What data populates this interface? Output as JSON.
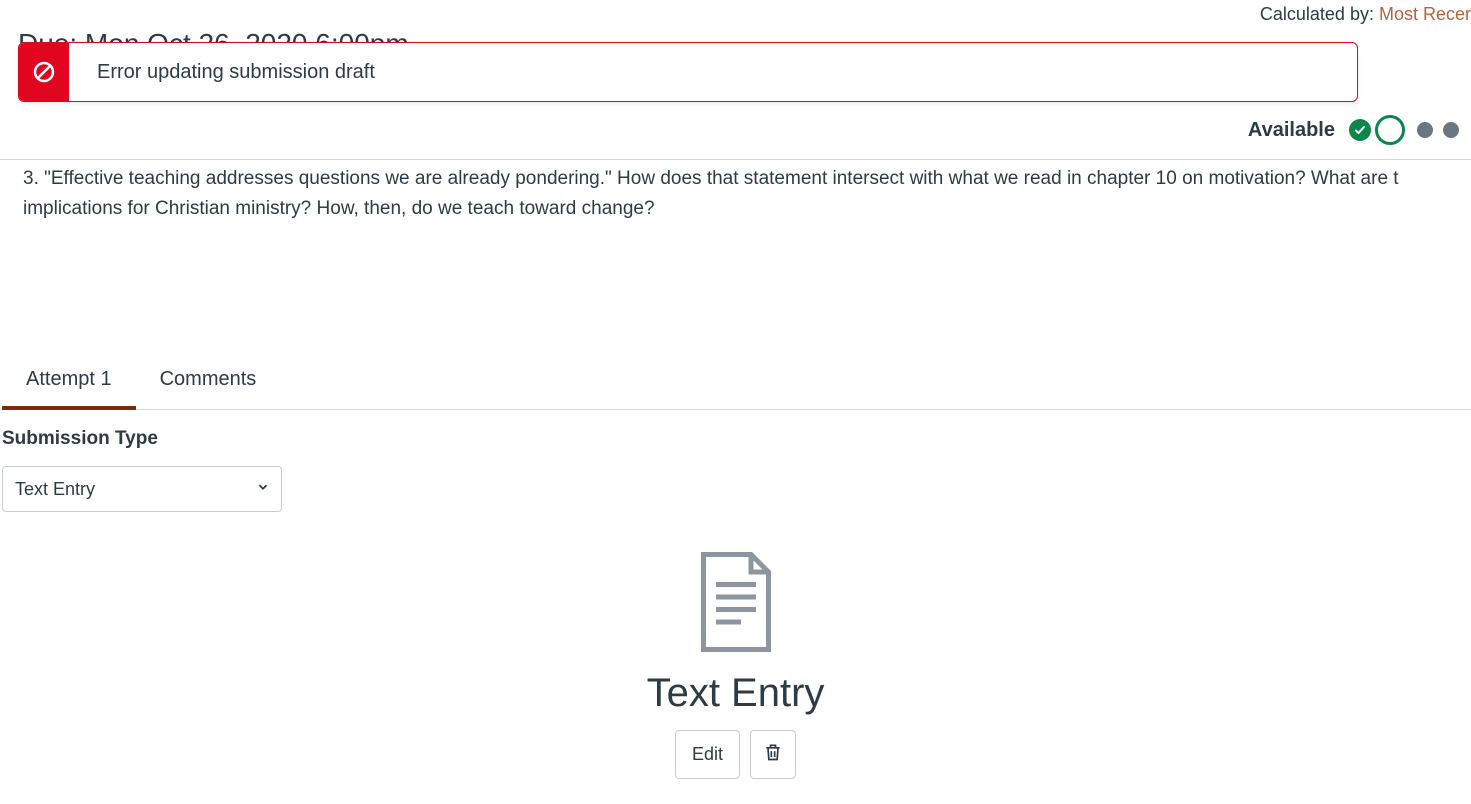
{
  "meta": {
    "calculated_by_label": "Calculated by: ",
    "calculated_by_value": "Most Recer"
  },
  "due": {
    "line": "Due: Mon Oct 26, 2020 6:00pm"
  },
  "alert": {
    "message": "Error updating submission draft"
  },
  "status": {
    "label": "Available"
  },
  "question": {
    "text": "3. \"Effective teaching addresses questions we are already pondering.\" How does that statement intersect with what we read in chapter 10 on motivation? What are t implications for Christian ministry? How, then, do we teach toward change?"
  },
  "tabs": {
    "attempt": "Attempt 1",
    "comments": "Comments"
  },
  "submission": {
    "type_label": "Submission Type",
    "selected": "Text Entry"
  },
  "entry": {
    "title": "Text Entry",
    "edit_label": "Edit"
  }
}
